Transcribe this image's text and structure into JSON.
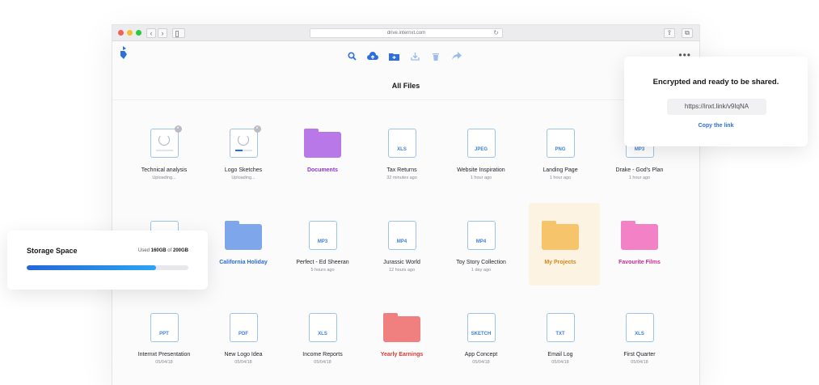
{
  "browser": {
    "url": "drive.internxt.com"
  },
  "app": {
    "title": "All Files"
  },
  "colors": {
    "accent": "#2c6fdc",
    "purple_folder": "#b878e8",
    "blue_folder": "#7ea6ea",
    "orange_folder": "#f6c46a",
    "pink_folder": "#f282c5",
    "red_folder": "#f07f7f"
  },
  "toolbar": {
    "icons": [
      "search-icon",
      "upload-icon",
      "new-folder-icon",
      "download-icon",
      "delete-icon",
      "share-icon"
    ]
  },
  "files": [
    {
      "name": "Technical analysis",
      "meta": "Uploading...",
      "kind": "uploading",
      "progress": 0.0
    },
    {
      "name": "Logo Sketches",
      "meta": "Uploading...",
      "kind": "uploading",
      "progress": 0.45
    },
    {
      "name": "Documents",
      "meta": "",
      "kind": "folder",
      "color": "#b878e8",
      "label_color": "#8d35d1"
    },
    {
      "name": "Tax Returns",
      "meta": "32 minutes ago",
      "kind": "file",
      "ext": "XLS"
    },
    {
      "name": "Website Inspiration",
      "meta": "1 hour ago",
      "kind": "file",
      "ext": "JPEG"
    },
    {
      "name": "Landing Page",
      "meta": "1 hour ago",
      "kind": "file",
      "ext": "PNG"
    },
    {
      "name": "Drake - God's Plan",
      "meta": "1 hour ago",
      "kind": "file",
      "ext": "MP3"
    },
    {
      "name": "",
      "meta": "",
      "kind": "file",
      "ext": ""
    },
    {
      "name": "California Holiday",
      "meta": "",
      "kind": "folder",
      "color": "#7ea6ea",
      "label_color": "#2e6bd4"
    },
    {
      "name": "Perfect - Ed Sheeran",
      "meta": "5 hours ago",
      "kind": "file",
      "ext": "MP3"
    },
    {
      "name": "Jurassic World",
      "meta": "12 hours ago",
      "kind": "file",
      "ext": "MP4"
    },
    {
      "name": "Toy Story Collection",
      "meta": "1 day ago",
      "kind": "file",
      "ext": "MP4"
    },
    {
      "name": "My Projects",
      "meta": "",
      "kind": "folder",
      "color": "#f6c46a",
      "label_color": "#d48a1a"
    },
    {
      "name": "Favourite Films",
      "meta": "",
      "kind": "folder",
      "color": "#f282c5",
      "label_color": "#cf2b93"
    },
    {
      "name": "Internxt Presentation",
      "meta": "05/04/18",
      "kind": "file",
      "ext": "PPT"
    },
    {
      "name": "New Logo Idea",
      "meta": "05/04/18",
      "kind": "file",
      "ext": "PDF"
    },
    {
      "name": "Income Reports",
      "meta": "05/04/18",
      "kind": "file",
      "ext": "XLS"
    },
    {
      "name": "Yearly Earnings",
      "meta": "",
      "kind": "folder",
      "color": "#f07f7f",
      "label_color": "#d93a3a"
    },
    {
      "name": "App Concept",
      "meta": "05/04/18",
      "kind": "file",
      "ext": "SKETCH"
    },
    {
      "name": "Email Log",
      "meta": "05/04/18",
      "kind": "file",
      "ext": "TXT"
    },
    {
      "name": "First Quarter",
      "meta": "05/04/18",
      "kind": "file",
      "ext": "XLS"
    }
  ],
  "storage": {
    "title": "Storage Space",
    "used_prefix": "Used",
    "used_value": "160GB",
    "used_of": "of",
    "total": "200GB",
    "fraction": 0.8
  },
  "share": {
    "title": "Encrypted and ready to be shared.",
    "link": "https://inxt.link/v9IqNA",
    "copy_label": "Copy the link"
  }
}
